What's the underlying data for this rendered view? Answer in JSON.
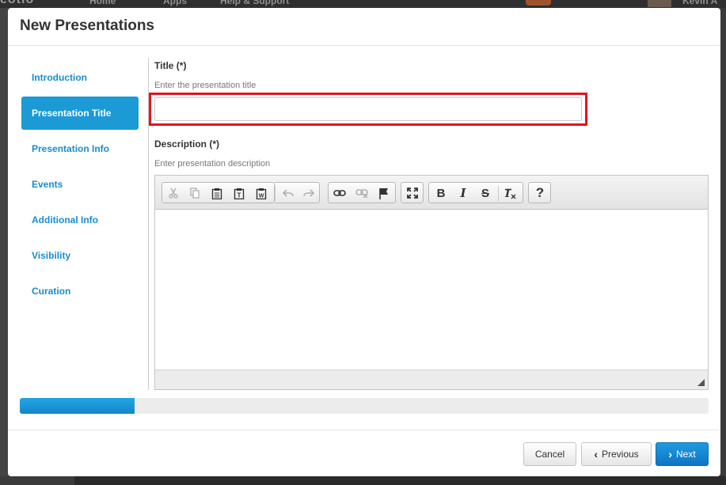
{
  "background": {
    "brand": "eotio",
    "nav_home": "Home",
    "nav_apps": "Apps",
    "nav_help": "Help & Support",
    "user_name": "Kevin A"
  },
  "modal": {
    "title": "New Presentations"
  },
  "sidebar": {
    "items": [
      {
        "label": "Introduction",
        "active": false
      },
      {
        "label": "Presentation Title",
        "active": true
      },
      {
        "label": "Presentation Info",
        "active": false
      },
      {
        "label": "Events",
        "active": false
      },
      {
        "label": "Additional Info",
        "active": false
      },
      {
        "label": "Visibility",
        "active": false
      },
      {
        "label": "Curation",
        "active": false
      }
    ]
  },
  "form": {
    "title_label": "Title (*)",
    "title_help": "Enter the presentation title",
    "title_value": "",
    "description_label": "Description (*)",
    "description_help": "Enter presentation description",
    "description_value": ""
  },
  "editor_toolbar": {
    "groups": [
      [
        "cut-icon",
        "copy-icon",
        "paste-icon",
        "paste-text-icon",
        "paste-from-word-icon",
        "undo-icon",
        "redo-icon"
      ],
      [
        "link-icon",
        "unlink-icon",
        "anchor-icon"
      ],
      [
        "maximize-icon"
      ],
      [
        "bold-icon",
        "italic-icon",
        "strikethrough-icon",
        "remove-format-icon"
      ],
      [
        "help-icon"
      ]
    ],
    "bold_glyph": "B",
    "italic_glyph": "I",
    "strike_glyph": "S",
    "help_glyph": "?"
  },
  "progress": {
    "percent": 16.7,
    "color": "#1b9ad6"
  },
  "footer": {
    "cancel_label": "Cancel",
    "previous_label": "Previous",
    "next_label": "Next"
  },
  "colors": {
    "accent": "#1b9ad6",
    "highlight_border": "#e0141e"
  }
}
